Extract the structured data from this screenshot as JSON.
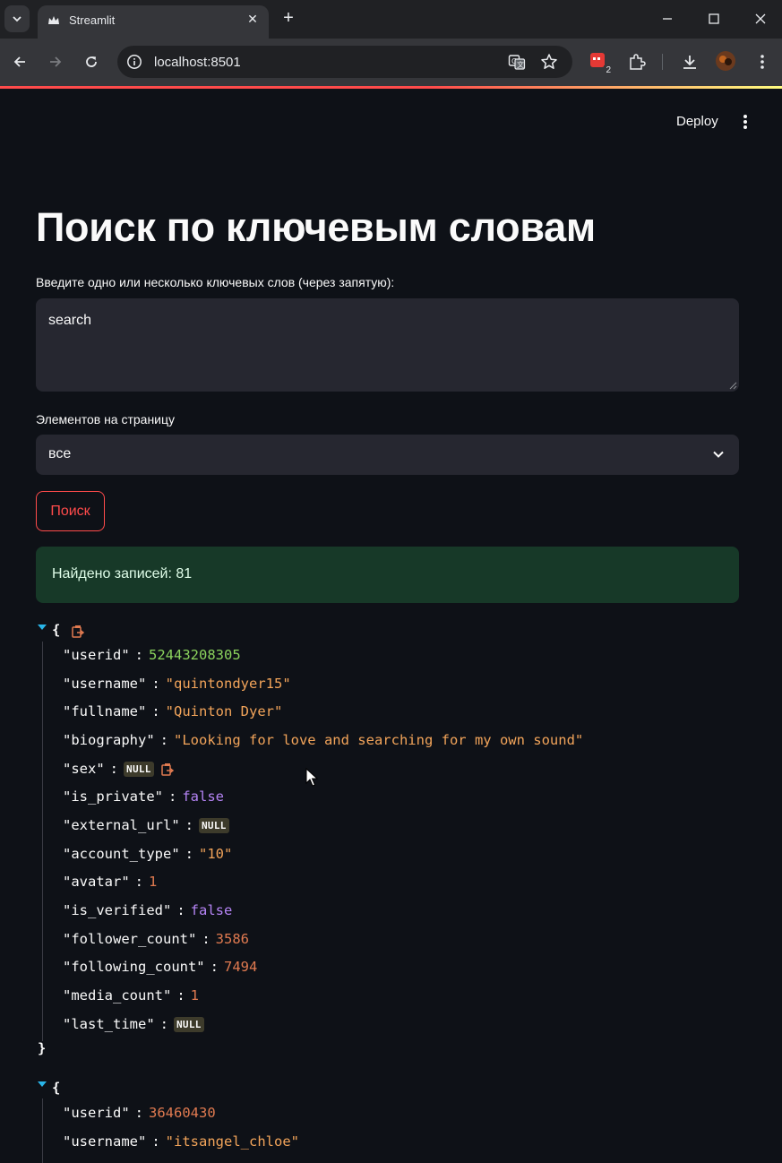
{
  "browser": {
    "tab_title": "Streamlit",
    "url": "localhost:8501",
    "extension_badge": "2"
  },
  "header": {
    "deploy_label": "Deploy"
  },
  "page": {
    "title": "Поиск по ключевым словам",
    "keywords_label": "Введите одно или несколько ключевых слов (через запятую):",
    "keywords_value": "search",
    "per_page_label": "Элементов на страницу",
    "per_page_value": "все",
    "search_button": "Поиск",
    "result_message": "Найдено записей: 81"
  },
  "records": [
    {
      "open_brace": "{",
      "close_brace": "}",
      "fields": [
        {
          "key": "\"userid\"",
          "value": "52443208305",
          "type": "number-green"
        },
        {
          "key": "\"username\"",
          "value": "\"quintondyer15\"",
          "type": "string"
        },
        {
          "key": "\"fullname\"",
          "value": "\"Quinton Dyer\"",
          "type": "string"
        },
        {
          "key": "\"biography\"",
          "value": "\"Looking for love and searching for my own sound\"",
          "type": "string"
        },
        {
          "key": "\"sex\"",
          "value": "NULL",
          "type": "null"
        },
        {
          "key": "\"is_private\"",
          "value": "false",
          "type": "bool"
        },
        {
          "key": "\"external_url\"",
          "value": "NULL",
          "type": "null"
        },
        {
          "key": "\"account_type\"",
          "value": "\"10\"",
          "type": "string"
        },
        {
          "key": "\"avatar\"",
          "value": "1",
          "type": "number"
        },
        {
          "key": "\"is_verified\"",
          "value": "false",
          "type": "bool"
        },
        {
          "key": "\"follower_count\"",
          "value": "3586",
          "type": "number"
        },
        {
          "key": "\"following_count\"",
          "value": "7494",
          "type": "number"
        },
        {
          "key": "\"media_count\"",
          "value": "1",
          "type": "number"
        },
        {
          "key": "\"last_time\"",
          "value": "NULL",
          "type": "null"
        }
      ]
    },
    {
      "open_brace": "{",
      "fields": [
        {
          "key": "\"userid\"",
          "value": "36460430",
          "type": "number"
        },
        {
          "key": "\"username\"",
          "value": "\"itsangel_chloe\"",
          "type": "string"
        }
      ]
    }
  ],
  "colon": ":",
  "colors": {
    "accent": "#ff4b4b",
    "background": "#0e1117",
    "success_bg": "#173928",
    "json_string": "#f2a45a",
    "json_number": "#e07a50",
    "json_bool": "#b584f5"
  }
}
